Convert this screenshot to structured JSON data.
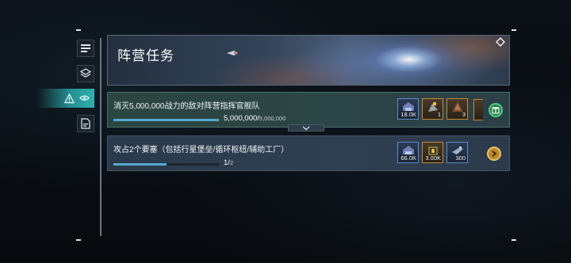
{
  "banner": {
    "title": "阵营任务"
  },
  "tasks": [
    {
      "title": "消灭5,000,000战力的敌对阵营指挥官舰队",
      "progress_current": "5,000,000/",
      "progress_total": "5,000,000",
      "progress_fraction": 1.0,
      "rewards": [
        {
          "icon": "fleet-hangar-icon",
          "qty": "18.0K"
        },
        {
          "icon": "ore-crate-icon",
          "qty": "1"
        },
        {
          "icon": "cargo-pod-icon",
          "qty": "3"
        }
      ],
      "action": "chest-icon"
    },
    {
      "title": "攻占2个要塞（包括行星堡垒/循环枢纽/辅助工厂）",
      "progress_current": "1/",
      "progress_total": "2",
      "progress_fraction": 0.5,
      "rewards": [
        {
          "icon": "fleet-hangar-icon",
          "qty": "66.0K"
        },
        {
          "icon": "resource-crystal-icon",
          "qty": "3.00K"
        },
        {
          "icon": "blueprint-ship-icon",
          "qty": "300"
        }
      ],
      "action": "arrow-right-icon"
    }
  ],
  "colors": {
    "accent": "#2fb0b0",
    "progress": "#55a9d0",
    "reward_gold": "#c88a33",
    "reward_blue": "#5b8ec9"
  }
}
